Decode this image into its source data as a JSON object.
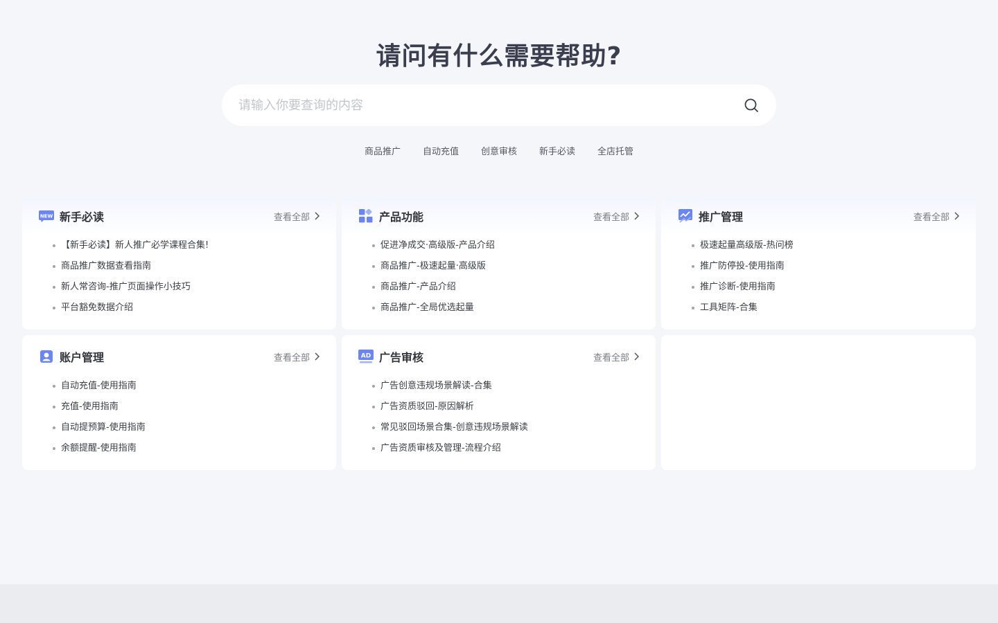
{
  "hero": {
    "title": "请问有什么需要帮助?",
    "search_placeholder": "请输入你要查询的内容",
    "hot_tags": [
      "商品推广",
      "自动充值",
      "创意审核",
      "新手必读",
      "全店托管"
    ]
  },
  "view_all_label": "查看全部",
  "cards": [
    {
      "title": "新手必读",
      "icon": "new-badge-icon",
      "items": [
        "【新手必读】新人推广必学课程合集!",
        "商品推广数据查看指南",
        "新人常咨询-推广页面操作小技巧",
        "平台豁免数据介绍"
      ]
    },
    {
      "title": "产品功能",
      "icon": "grid-apps-icon",
      "items": [
        "促进净成交·高级版-产品介绍",
        "商品推广-极速起量·高级版",
        "商品推广-产品介绍",
        "商品推广-全局优选起量"
      ]
    },
    {
      "title": "推广管理",
      "icon": "trend-chart-icon",
      "items": [
        "极速起量高级版-热问榜",
        "推广防停投-使用指南",
        "推广诊断-使用指南",
        "工具矩阵-合集"
      ]
    },
    {
      "title": "账户管理",
      "icon": "account-user-icon",
      "items": [
        "自动充值-使用指南",
        "充值-使用指南",
        "自动提预算-使用指南",
        "余额提醒-使用指南"
      ]
    },
    {
      "title": "广告审核",
      "icon": "ad-badge-icon",
      "items": [
        "广告创意违规场景解读-合集",
        "广告资质驳回-原因解析",
        "常见驳回场景合集-创意违规场景解读",
        "广告资质审核及管理-流程介绍"
      ]
    }
  ],
  "colors": {
    "page_bg": "#f5f6fa",
    "card_bg": "#ffffff",
    "accent": "#6b86f0",
    "title_text": "#3b3e4f"
  }
}
